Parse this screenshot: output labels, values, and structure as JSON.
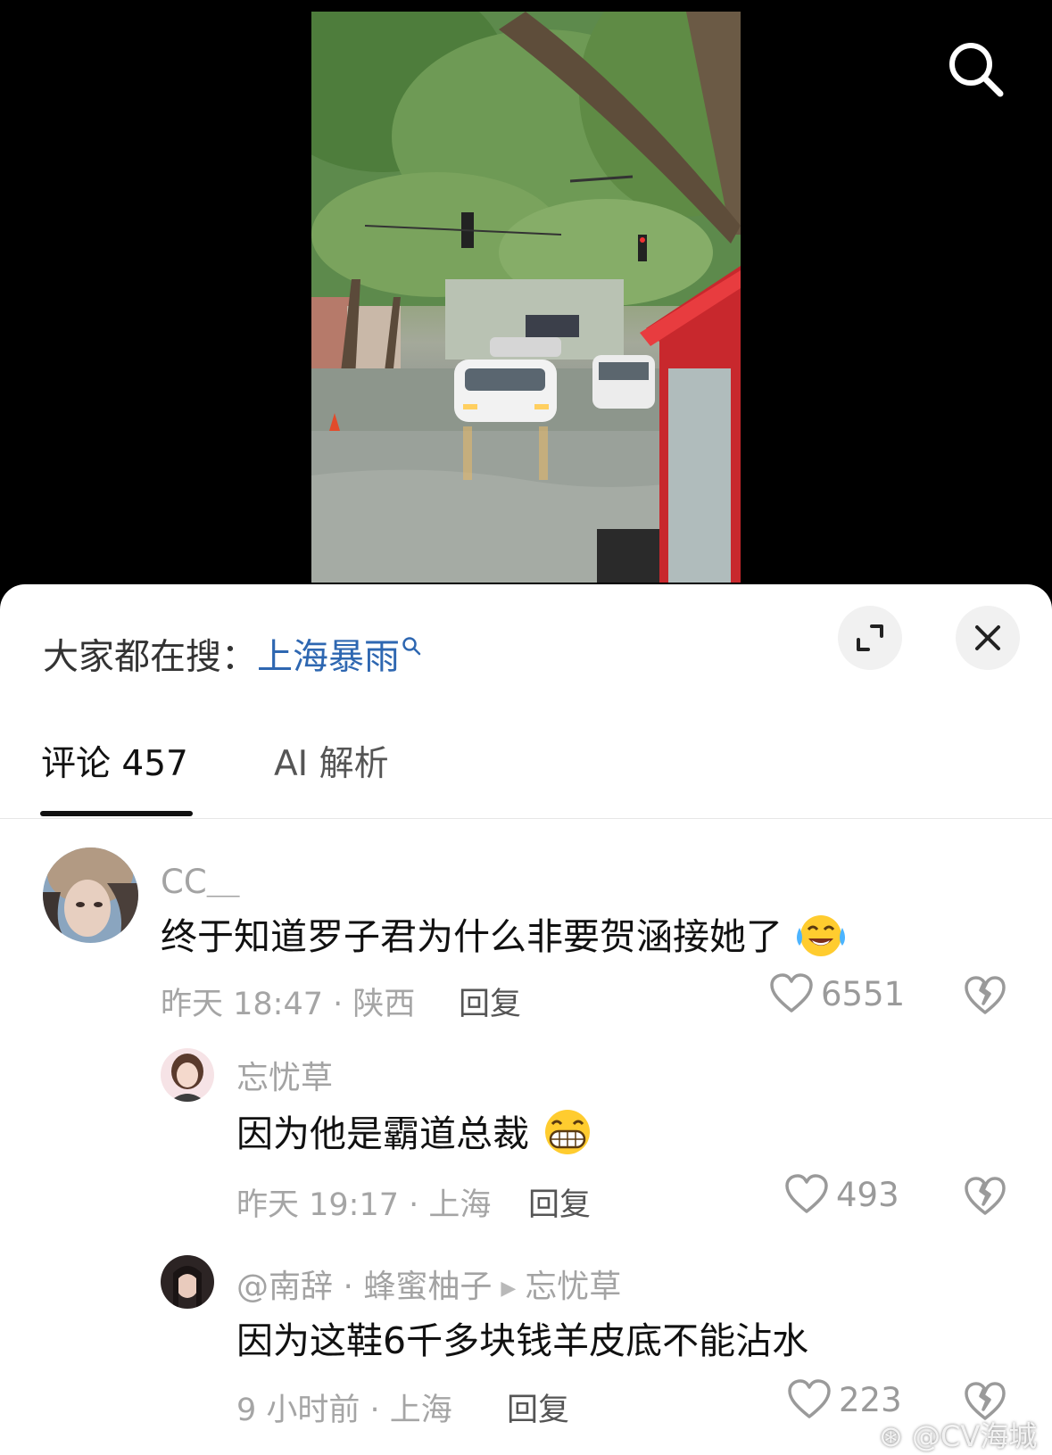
{
  "hot_search": {
    "prefix": "大家都在搜：",
    "keyword": "上海暴雨"
  },
  "tabs": [
    {
      "label": "评论 457",
      "active": true
    },
    {
      "label": "AI 解析",
      "active": false
    }
  ],
  "comments": [
    {
      "username": "CC＿",
      "content": "终于知道罗子君为什么非要贺涵接她了",
      "emoji": "crying-laughing-emoji",
      "meta": "昨天 18:47 · 陕西",
      "reply_label": "回复",
      "likes": "6551"
    },
    {
      "username": "忘忧草",
      "content": "因为他是霸道总裁",
      "emoji": "grinning-emoji",
      "meta": "昨天 19:17 · 上海",
      "reply_label": "回复",
      "likes": "493"
    },
    {
      "username": "@南辞 · 蜂蜜柚子",
      "reply_to": "忘忧草",
      "content": "因为这鞋6千多块钱羊皮底不能沾水",
      "meta": "9 小时前 · 上海",
      "reply_label": "回复",
      "likes": "223"
    }
  ],
  "watermark": "@CV海城",
  "colors": {
    "keyword": "#2e67b1",
    "muted": "#a3a3a3",
    "text": "#111111",
    "background": "#ffffff"
  }
}
